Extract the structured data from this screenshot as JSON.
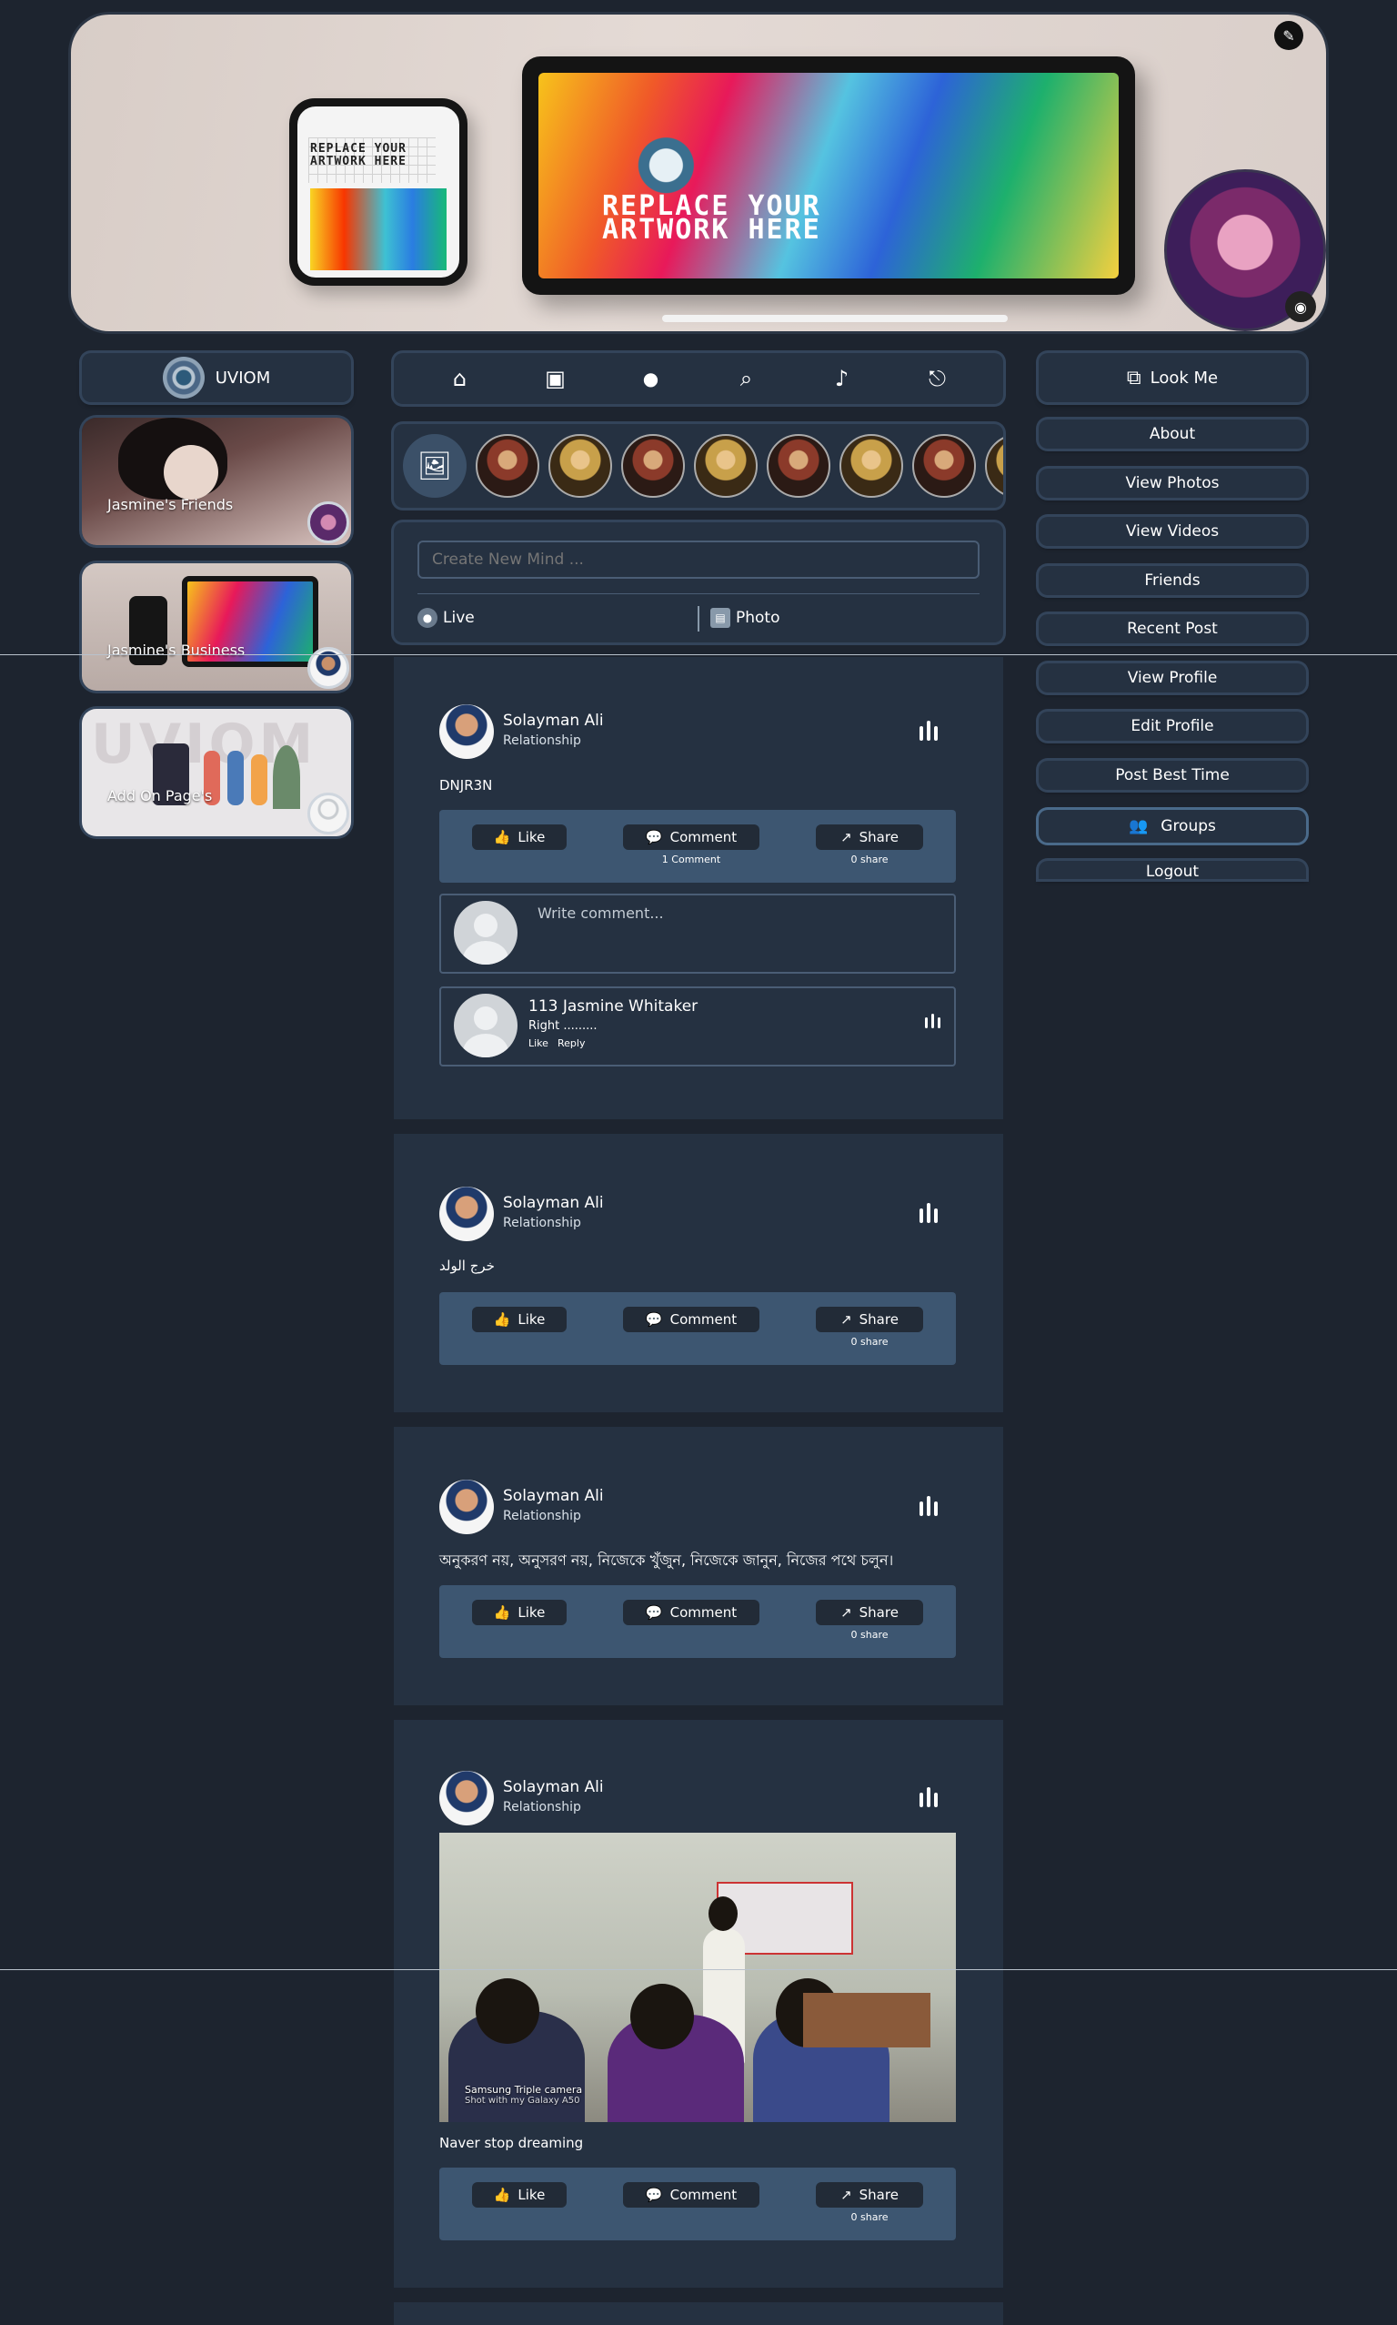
{
  "cover": {
    "phone_art_text": "REPLACE YOUR ARTWORK HERE",
    "tablet_art_text": "REPLACE YOUR ARTWORK HERE",
    "edit_icon": "pencil-icon",
    "camera_icon": "camera-icon"
  },
  "left": {
    "brand": "UVIOM",
    "pages": [
      {
        "label": "Jasmine's Friends"
      },
      {
        "label": "Jasmine's Business"
      },
      {
        "label": "Add On Page's"
      }
    ]
  },
  "nav": {
    "icons": [
      "home-icon",
      "video-icon",
      "chat-icon",
      "search-icon",
      "bell-icon",
      "logout-icon"
    ]
  },
  "composer": {
    "placeholder": "Create New Mind ...",
    "live_label": "Live",
    "photo_label": "Photo"
  },
  "posts": [
    {
      "name": "Solayman Ali",
      "sub": "Relationship",
      "text": "DNJR3N",
      "like": "Like",
      "comment": "Comment",
      "share": "Share",
      "comment_count": "1 Comment",
      "share_count": "0 share",
      "write_placeholder": "Write comment...",
      "reply": {
        "name": "113 Jasmine Whitaker",
        "text": "Right .........",
        "like": "Like",
        "reply": "Reply"
      }
    },
    {
      "name": "Solayman Ali",
      "sub": "Relationship",
      "text": "خرج الولد",
      "like": "Like",
      "comment": "Comment",
      "share": "Share",
      "share_count": "0 share"
    },
    {
      "name": "Solayman Ali",
      "sub": "Relationship",
      "text": "অনুকরণ নয়, অনুসরণ নয়, নিজেকে খুঁজুন, নিজেকে জানুন, নিজের পথে চলুন।",
      "like": "Like",
      "comment": "Comment",
      "share": "Share",
      "share_count": "0 share"
    },
    {
      "name": "Solayman Ali",
      "sub": "Relationship",
      "photo_caption_1": "Samsung Triple camera",
      "photo_caption_2": "Shot with my Galaxy A50",
      "text": "Naver stop dreaming",
      "like": "Like",
      "comment": "Comment",
      "share": "Share",
      "share_count": "0 share"
    }
  ],
  "right": {
    "look_me": "Look Me",
    "menu": [
      "About",
      "View Photos",
      "View Videos",
      "Friends",
      "Recent Post",
      "View Profile",
      "Edit Profile",
      "Post Best Time"
    ],
    "groups": "Groups",
    "logout": "Logout"
  }
}
